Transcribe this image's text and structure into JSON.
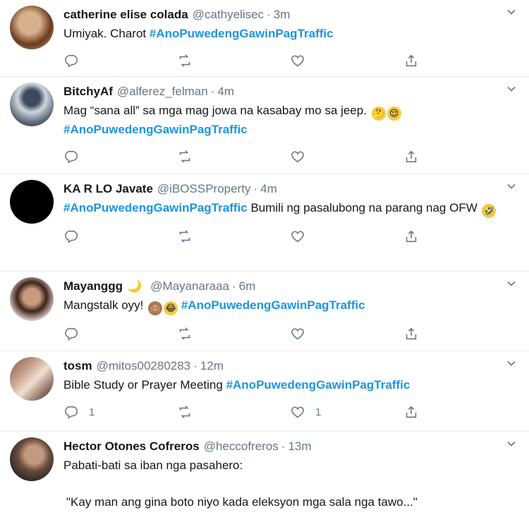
{
  "tweets": [
    {
      "name": "catherine elise colada",
      "handle": "@cathyelisec",
      "time": "3m",
      "text_before": "Umiyak. Charot ",
      "hashtag": "#AnoPuwedengGawinPagTraffic",
      "text_after": "",
      "reply_count": "",
      "like_count": ""
    },
    {
      "name": "BitchyAf",
      "handle": "@alferez_felman",
      "time": "4m",
      "text_before": "Mag “sana all” sa mga mag jowa na kasabay mo sa jeep. ",
      "emojis": [
        "thinking-face-emoji",
        "relieved-face-emoji"
      ],
      "hashtag": "#AnoPuwedengGawinPagTraffic",
      "reply_count": "",
      "like_count": ""
    },
    {
      "name": "KA R LO Javate",
      "handle": "@iBOSSProperty",
      "time": "4m",
      "hashtag": "#AnoPuwedengGawinPagTraffic",
      "text_after": " Bumili ng pasalubong na parang nag OFW ",
      "emojis": [
        "rolling-laughing-emoji"
      ],
      "reply_count": "",
      "like_count": ""
    },
    {
      "name": "Mayanggg",
      "moon": "🌙",
      "handle": "@Mayanaraaa",
      "time": "6m",
      "text_before": "Mangstalk oyy! ",
      "emojis": [
        "see-no-evil-monkey-emoji",
        "joy-face-emoji"
      ],
      "hashtag": "#AnoPuwedengGawinPagTraffic",
      "reply_count": "",
      "like_count": ""
    },
    {
      "name": "tosm",
      "handle": "@mitos00280283",
      "time": "12m",
      "text_before": "Bible Study or Prayer Meeting ",
      "hashtag": "#AnoPuwedengGawinPagTraffic",
      "reply_count": "1",
      "like_count": "1"
    },
    {
      "name": "Hector Otones Cofreros",
      "handle": "@heccofreros",
      "time": "13m",
      "text_before": "Pabati-bati sa iban nga pasahero:",
      "quote": "\"Kay man ang gina boto niyo kada eleksyon mga sala nga tawo...\""
    }
  ],
  "dot": "·",
  "colors": {
    "hashtag": "#1b95e0",
    "muted": "#657786",
    "divider": "#e6ecf0"
  }
}
